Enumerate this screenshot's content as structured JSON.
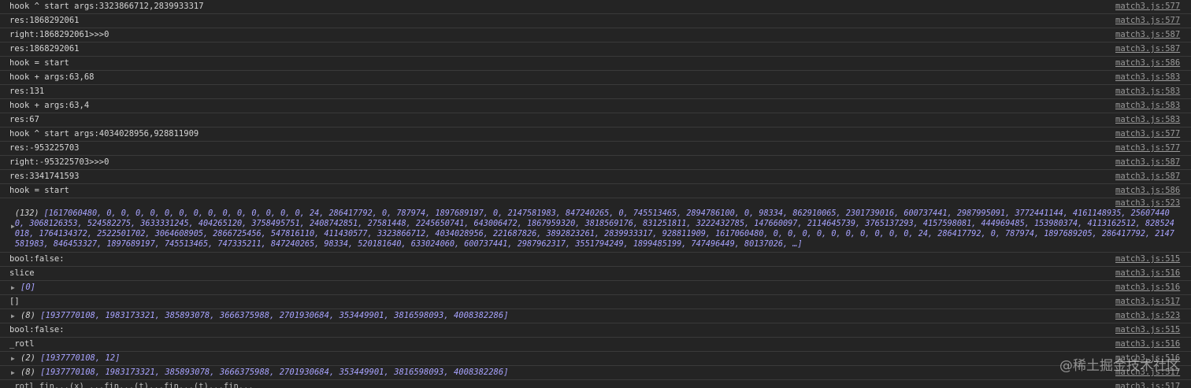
{
  "console": {
    "rows_top": [
      {
        "msg": "hook ^ start args:3323866712,2839933317",
        "src": "match3.js:577"
      },
      {
        "msg": "res:1868292061",
        "src": "match3.js:577"
      },
      {
        "msg": "right:1868292061>>>0",
        "src": "match3.js:587"
      },
      {
        "msg": "res:1868292061",
        "src": "match3.js:587"
      },
      {
        "msg": "hook = start",
        "src": "match3.js:586"
      },
      {
        "msg": "hook + args:63,68",
        "src": "match3.js:583"
      },
      {
        "msg": "res:131",
        "src": "match3.js:583"
      },
      {
        "msg": "hook + args:63,4",
        "src": "match3.js:583"
      },
      {
        "msg": "res:67",
        "src": "match3.js:583"
      },
      {
        "msg": "hook ^ start args:4034028956,928811909",
        "src": "match3.js:577"
      },
      {
        "msg": "res:-953225703",
        "src": "match3.js:577"
      },
      {
        "msg": "right:-953225703>>>0",
        "src": "match3.js:587"
      },
      {
        "msg": "res:3341741593",
        "src": "match3.js:587"
      },
      {
        "msg": "hook = start",
        "src": "match3.js:586"
      }
    ],
    "big_array": {
      "src": "match3.js:523",
      "count": "(132) ",
      "values": "[1617060480, 0, 0, 0, 0, 0, 0, 0, 0, 0, 0, 0, 0, 0, 0, 24, 286417792, 0, 787974, 1897689197, 0, 2147581983, 847240265, 0, 745513465, 2894786100, 0, 98334, 862910065, 2301739016, 600737441, 2987995091, 3772441144, 4161148935, 256074400, 3068126353, 524582275, 3633331245, 404265120, 3758495751, 2408742851, 27581448, 2245650741, 643006472, 1867959320, 3818569176, 831251811, 3222432785, 147660097, 2114645739, 3765137293, 4157598081, 444969485, 153980374, 4113162512, 828524018, 1764134372, 2522501702, 3064608905, 2866725456, 547816110, 411430577, 3323866712, 4034028956, 221687826, 3892823261, 2839933317, 928811909, 1617060480, 0, 0, 0, 0, 0, 0, 0, 0, 0, 0, 24, 286417792, 0, 787974, 1897689205, 286417792, 2147581983, 846453327, 1897689197, 745513465, 747335211, 847240265, 98334, 520181640, 633024060, 600737441, 2987962317, 3551794249, 1899485199, 747496449, 80137026, …]"
    },
    "rows_bottom": [
      {
        "type": "text",
        "msg": "bool:false:",
        "src": "match3.js:515"
      },
      {
        "type": "text",
        "msg": "slice",
        "src": "match3.js:516"
      },
      {
        "type": "obj",
        "count": "",
        "values": "[0]",
        "src": "match3.js:516"
      },
      {
        "type": "text",
        "msg": "[]",
        "src": "match3.js:517"
      },
      {
        "type": "obj",
        "count": "(8) ",
        "values": "[1937770108, 1983173321, 385893078, 3666375988, 2701930684, 353449901, 3816598093, 4008382286]",
        "src": "match3.js:523"
      },
      {
        "type": "text",
        "msg": "bool:false:",
        "src": "match3.js:515"
      },
      {
        "type": "text",
        "msg": "_rotl",
        "src": "match3.js:516"
      },
      {
        "type": "obj",
        "count": "(2) ",
        "values": "[1937770108, 12]",
        "src": "match3.js:516"
      },
      {
        "type": "obj",
        "count": "(8) ",
        "values": "[1937770108, 1983173321, 385893078, 3666375988, 2701930684, 353449901, 3816598093, 4008382286]",
        "src": "match3.js:517"
      }
    ],
    "partial_last": {
      "msg": "_rotl fin...(x) ...fin...(t)...fin...(t)...fin...",
      "src": "match3.js:517"
    }
  },
  "watermark": "@稀土掘金技术社区",
  "icons": {
    "expand": "triangle-right-icon"
  },
  "colors": {
    "background": "#242424",
    "text": "#d5d5d5",
    "array": "#a8a3ff",
    "source": "#9a9a9a"
  }
}
